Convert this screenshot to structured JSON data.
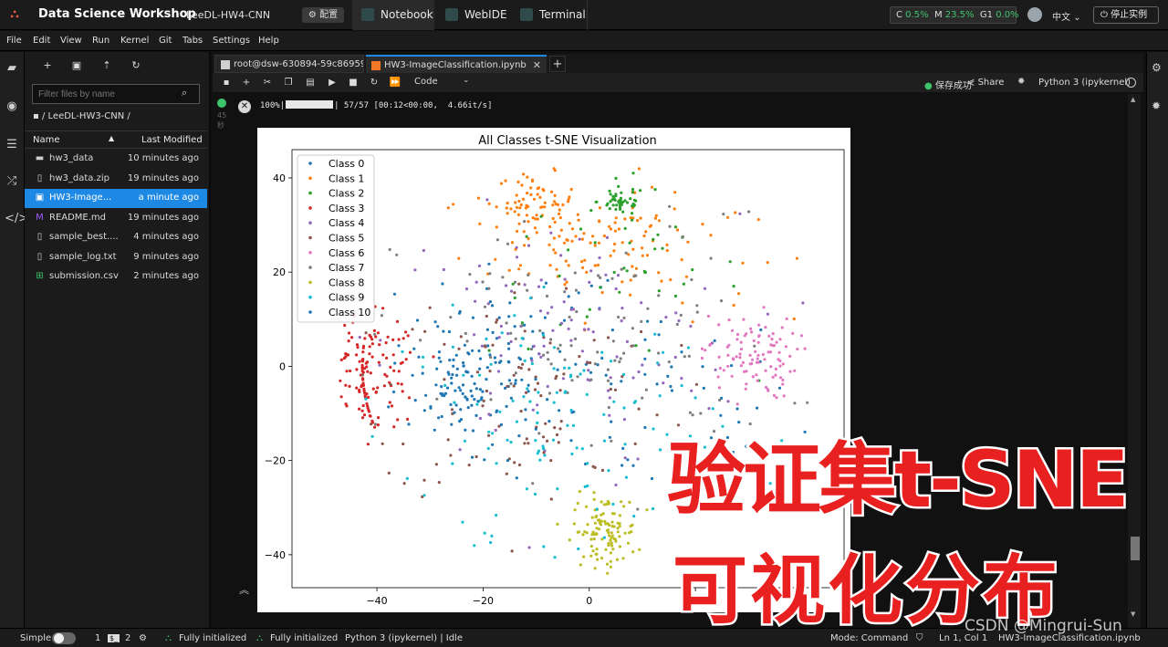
{
  "topbar": {
    "app_title": "Data Science Workshop",
    "project": "LeeDL-HW4-CNN",
    "config_label": "配置",
    "tabs": [
      "Notebook",
      "WebIDE",
      "Terminal"
    ],
    "resources": {
      "c_label": "C",
      "c_val": "0.5%",
      "m_label": "M",
      "m_val": "23.5%",
      "g_label": "G1",
      "g_val": "0.0%"
    },
    "language": "中文",
    "stop_label": "停止实例"
  },
  "menu": [
    "File",
    "Edit",
    "View",
    "Run",
    "Kernel",
    "Git",
    "Tabs",
    "Settings",
    "Help"
  ],
  "filebrowser": {
    "filter_placeholder": "Filter files by name",
    "breadcrumb": "/ LeeDL-HW3-CNN /",
    "col_name": "Name",
    "col_modified": "Last Modified",
    "files": [
      {
        "name": "hw3_data",
        "modified": "10 minutes ago",
        "icon": "folder-icon"
      },
      {
        "name": "hw3_data.zip",
        "modified": "19 minutes ago",
        "icon": "file-icon"
      },
      {
        "name": "HW3-Image...",
        "modified": "a minute ago",
        "icon": "notebook-icon"
      },
      {
        "name": "README.md",
        "modified": "19 minutes ago",
        "icon": "markdown-icon"
      },
      {
        "name": "sample_best....",
        "modified": "4 minutes ago",
        "icon": "file-icon"
      },
      {
        "name": "sample_log.txt",
        "modified": "9 minutes ago",
        "icon": "file-icon"
      },
      {
        "name": "submission.csv",
        "modified": "2 minutes ago",
        "icon": "csv-icon"
      }
    ]
  },
  "doc_tabs": {
    "terminal": "root@dsw-630894-59c86959",
    "notebook": "HW3-ImageClassification.ipynb"
  },
  "toolbar": {
    "cell_type": "Code",
    "save_status": "保存成功",
    "share": "Share",
    "kernel": "Python 3 (ipykernel)"
  },
  "cell": {
    "gutter": "45\n秒",
    "progress_pct": "100%|",
    "progress_rest": "| 57/57 [00:12<00:00,  4.66it/s]"
  },
  "chart_data": {
    "type": "scatter",
    "title": "All Classes t-SNE Visualization",
    "xlim": [
      -56,
      48
    ],
    "ylim": [
      -47,
      46
    ],
    "xticks": [
      -40,
      -20,
      0,
      20
    ],
    "yticks": [
      40,
      20,
      0,
      -20,
      -40
    ],
    "legend_position": "top-left",
    "colors": [
      "#1f77b4",
      "#ff7f0e",
      "#2ca02c",
      "#d62728",
      "#9467bd",
      "#8c564b",
      "#e377c2",
      "#7f7f7f",
      "#bcbd22",
      "#17becf",
      "#1f77b4"
    ],
    "series": [
      {
        "name": "Class 0",
        "clusters": [
          [
            -15,
            5,
            14,
            11
          ],
          [
            12,
            -8,
            18,
            14
          ]
        ],
        "n": 110
      },
      {
        "name": "Class 1",
        "clusters": [
          [
            -5,
            28,
            12,
            8
          ],
          [
            10,
            25,
            14,
            10
          ],
          [
            -10,
            35,
            5,
            4
          ]
        ],
        "n": 190
      },
      {
        "name": "Class 2",
        "clusters": [
          [
            5,
            20,
            16,
            12
          ],
          [
            6,
            35,
            3,
            2
          ]
        ],
        "n": 90
      },
      {
        "name": "Class 3",
        "clusters": [
          [
            -42,
            -2,
            7,
            8
          ]
        ],
        "n": 130
      },
      {
        "name": "Class 4",
        "clusters": [
          [
            -5,
            5,
            22,
            18
          ]
        ],
        "n": 110
      },
      {
        "name": "Class 5",
        "clusters": [
          [
            -12,
            -5,
            18,
            16
          ]
        ],
        "n": 100
      },
      {
        "name": "Class 6",
        "clusters": [
          [
            30,
            2,
            6,
            6
          ]
        ],
        "n": 100
      },
      {
        "name": "Class 7",
        "clusters": [
          [
            0,
            5,
            24,
            18
          ]
        ],
        "n": 110
      },
      {
        "name": "Class 8",
        "clusters": [
          [
            3,
            -35,
            4,
            5
          ]
        ],
        "n": 110
      },
      {
        "name": "Class 9",
        "clusters": [
          [
            -5,
            -12,
            20,
            16
          ]
        ],
        "n": 120
      },
      {
        "name": "Class 10",
        "clusters": [
          [
            -22,
            -5,
            8,
            8
          ]
        ],
        "n": 110
      }
    ]
  },
  "statusbar": {
    "mode_simple": "Simple",
    "count1": "1",
    "terminal_badge": "$_",
    "count2": "2",
    "init1": "Fully initialized",
    "init2": "Fully initialized",
    "kernel_status": "Python 3 (ipykernel) | Idle",
    "mode": "Mode: Command",
    "position": "Ln 1, Col 1",
    "file": "HW3-ImageClassification.ipynb"
  },
  "overlay": {
    "line1": "验证集t-SNE",
    "line2": "可视化分布",
    "watermark": "CSDN @Mingrui-Sun"
  }
}
